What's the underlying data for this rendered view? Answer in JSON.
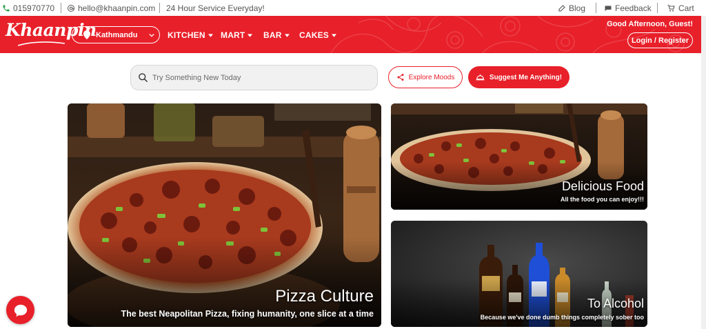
{
  "topbar": {
    "phone": "015970770",
    "email": "hello@khaanpin.com",
    "service": "24 Hour Service Everyday!",
    "blog": "Blog",
    "feedback": "Feedback",
    "cart": "Cart"
  },
  "nav": {
    "logo": "Khaanpin",
    "location": "Kathmandu",
    "menu": [
      {
        "label": "KITCHEN"
      },
      {
        "label": "MART"
      },
      {
        "label": "BAR"
      },
      {
        "label": "CAKES"
      }
    ],
    "greeting": "Good Afternoon, Guest!",
    "login": "Login / Register"
  },
  "search": {
    "placeholder": "Try Something New Today",
    "explore": "Explore Moods",
    "suggest": "Suggest Me Anything!"
  },
  "cards": [
    {
      "title": "Pizza Culture",
      "subtitle": "The best Neapolitan Pizza, fixing humanity, one slice at a time"
    },
    {
      "title": "Delicious Food",
      "subtitle": "All the food you can enjoy!!!"
    },
    {
      "title": "To Alcohol",
      "subtitle": "Because we've done dumb things completely sober too"
    }
  ],
  "colors": {
    "brand": "#e8202a",
    "icons": [
      "phone-icon",
      "mail-icon",
      "blog-icon",
      "feedback-icon",
      "cart-icon",
      "location-pin-icon",
      "chevron-down-icon",
      "search-icon",
      "share-icon",
      "cloche-icon",
      "chat-icon"
    ]
  }
}
